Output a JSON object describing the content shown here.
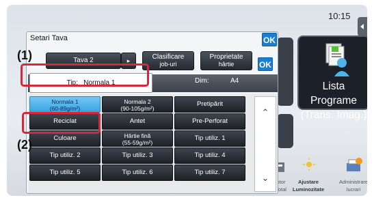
{
  "clock": "10:15",
  "background": {
    "app_tile_label_1": "Lista Programe",
    "app_tile_label_2": "(Trans. Imag.)",
    "bottom_items": [
      {
        "label_1": "ntor",
        "label_2": "Total"
      },
      {
        "label_1": "Ajustare",
        "label_2": "Luminozitate"
      },
      {
        "label_1": "Administrare",
        "label_2": "lucrari"
      }
    ]
  },
  "dialog": {
    "title": "Setari Tava",
    "ok_label": "OK",
    "tray_button": "Tava 2",
    "sort_button_1": "Clasificare",
    "sort_button_2": "job-uri",
    "prop_button_1": "Proprietate",
    "prop_button_2": "hârtie",
    "tip_label": "Tip:",
    "tip_value": "Normala 1",
    "dim_label": "Dim:",
    "dim_value": "A4",
    "paper_types": [
      {
        "l1": "Normala 1",
        "l2": "(60-89g/m²)",
        "selected": true
      },
      {
        "l1": "Normala 2",
        "l2": "(90-105g/m²)",
        "selected": false
      },
      {
        "l1": "Pretipărit",
        "l2": "",
        "selected": false
      },
      {
        "l1": "Reciclat",
        "l2": "",
        "selected": false
      },
      {
        "l1": "Antet",
        "l2": "",
        "selected": false
      },
      {
        "l1": "Pre-Perforat",
        "l2": "",
        "selected": false
      },
      {
        "l1": "Culoare",
        "l2": "",
        "selected": false
      },
      {
        "l1": "Hârtie fină",
        "l2": "(55-59g/m²)",
        "selected": false
      },
      {
        "l1": "Tip utiliz. 1",
        "l2": "",
        "selected": false
      },
      {
        "l1": "Tip utiliz. 2",
        "l2": "",
        "selected": false
      },
      {
        "l1": "Tip utiliz. 3",
        "l2": "",
        "selected": false
      },
      {
        "l1": "Tip utiliz. 4",
        "l2": "",
        "selected": false
      },
      {
        "l1": "Tip utiliz. 5",
        "l2": "",
        "selected": false
      },
      {
        "l1": "Tip utiliz. 6",
        "l2": "",
        "selected": false
      },
      {
        "l1": "Tip utiliz. 7",
        "l2": "",
        "selected": false
      }
    ]
  },
  "callouts": {
    "one": "(1)",
    "two": "(2)"
  },
  "colors": {
    "highlight": "#d7263d",
    "ok_blue": "#1a7ed4",
    "selected_cell": "#3aa3e2"
  },
  "icons": {
    "scroll_up": "double-chevron-up-icon",
    "scroll_down": "double-chevron-down-icon"
  }
}
